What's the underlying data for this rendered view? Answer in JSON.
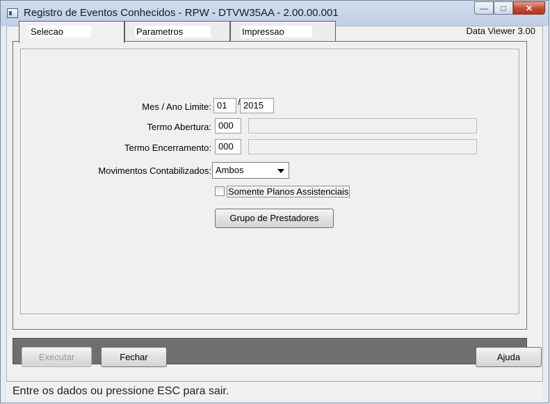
{
  "window": {
    "title": "Registro de Eventos Conhecidos - RPW - DTVW35AA - 2.00.00.001",
    "minimize_glyph": "—",
    "maximize_glyph": "□",
    "close_glyph": "✕"
  },
  "tabs": [
    {
      "label": "Selecao",
      "active": true
    },
    {
      "label": "Parametros",
      "active": false
    },
    {
      "label": "Impressao",
      "active": false
    }
  ],
  "viewer_label": "Data Viewer 3.00",
  "form": {
    "mes_ano_label": "Mes / Ano Limite:",
    "mes_value": "01",
    "separator": "/",
    "ano_value": "2015",
    "termo_abertura_label": "Termo Abertura:",
    "termo_abertura_value": "000",
    "termo_abertura_desc": "",
    "termo_encerramento_label": "Termo Encerramento:",
    "termo_encerramento_value": "000",
    "termo_encerramento_desc": "",
    "movimentos_label": "Movimentos Contabilizados:",
    "movimentos_value": "Ambos",
    "somente_planos_label": "Somente Planos Assistenciais",
    "somente_planos_checked": false,
    "grupo_button": "Grupo de Prestadores"
  },
  "actions": {
    "executar": "Executar",
    "fechar": "Fechar",
    "ajuda": "Ajuda"
  },
  "status_text": "Entre os dados ou pressione ESC para sair.",
  "colors": {
    "bottom_bar": "#6f6f6f",
    "close_button": "#c8462d"
  }
}
